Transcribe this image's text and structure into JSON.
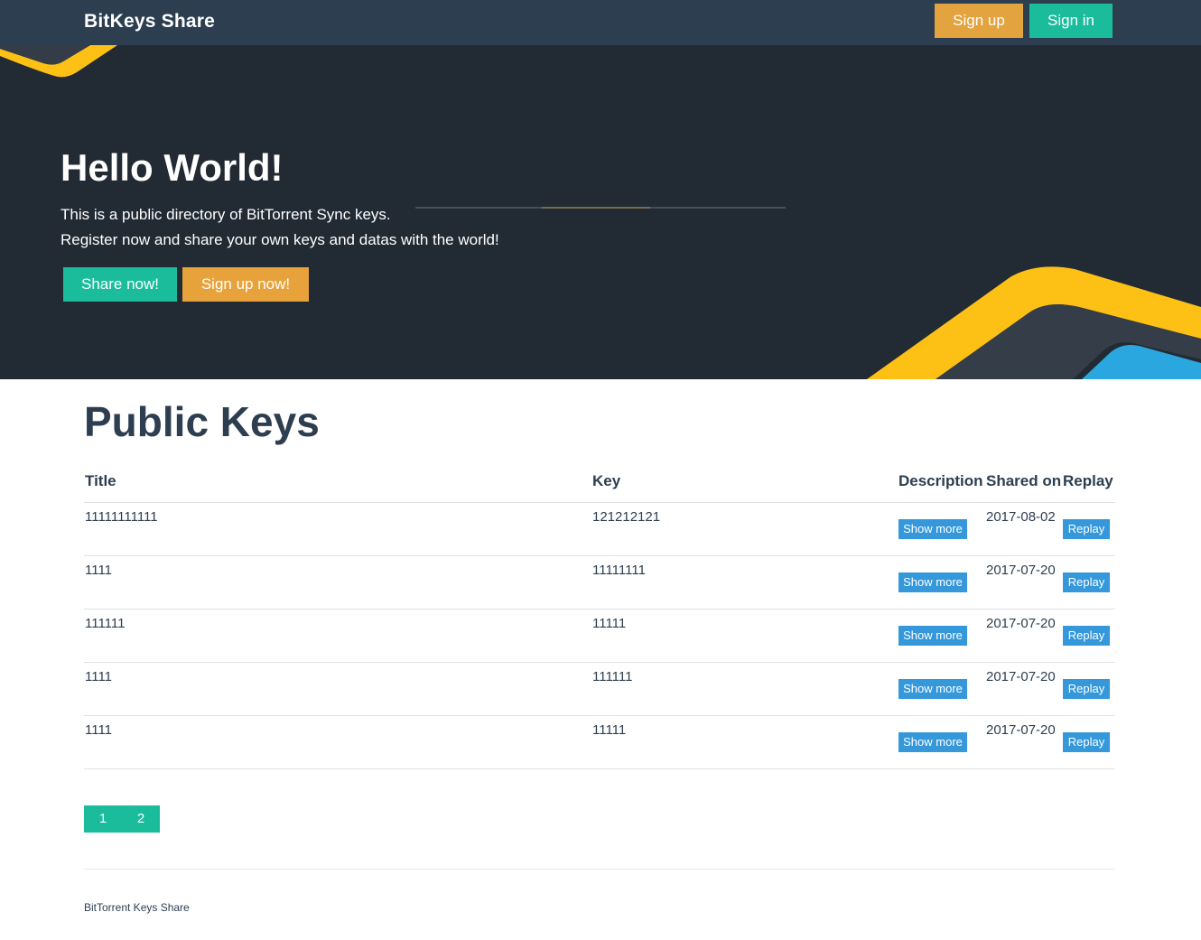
{
  "navbar": {
    "brand": "BitKeys Share",
    "signup_label": "Sign up",
    "signin_label": "Sign in"
  },
  "hero": {
    "title": "Hello World!",
    "line1": "This is a public directory of BitTorrent Sync keys.",
    "line2": "Register now and share your own keys and datas with the world!",
    "share_label": "Share now!",
    "signup_label": "Sign up now!"
  },
  "section": {
    "title": "Public Keys"
  },
  "table": {
    "headers": {
      "title": "Title",
      "key": "Key",
      "description": "Description",
      "shared_on": "Shared on",
      "replay": "Replay"
    },
    "show_more_label": "Show more",
    "replay_label": "Replay",
    "rows": [
      {
        "title": "11111111111",
        "key": "121212121",
        "date": "2017-08-02"
      },
      {
        "title": "1111",
        "key": "11111111",
        "date": "2017-07-20"
      },
      {
        "title": "111111",
        "key": "11111",
        "date": "2017-07-20"
      },
      {
        "title": "1111",
        "key": "111111",
        "date": "2017-07-20"
      },
      {
        "title": "1111",
        "key": "11111",
        "date": "2017-07-20"
      }
    ]
  },
  "pagination": {
    "pages": [
      "1",
      "2"
    ]
  },
  "footer": {
    "text": "BitTorrent Keys Share"
  },
  "colors": {
    "navbar_bg": "#2c3e50",
    "hero_bg": "#222a33",
    "primary_teal": "#1abc9c",
    "accent_orange": "#e3a33f",
    "button_blue": "#3498db",
    "deco_yellow": "#fdc116"
  }
}
